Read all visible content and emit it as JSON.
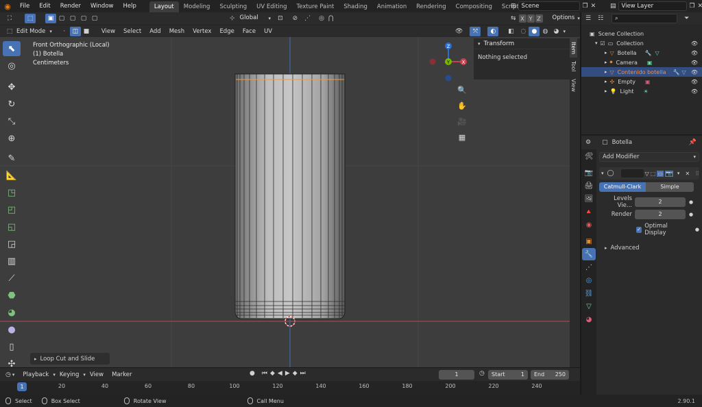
{
  "menu": [
    "File",
    "Edit",
    "Render",
    "Window",
    "Help"
  ],
  "workspaces": [
    "Layout",
    "Modeling",
    "Sculpting",
    "UV Editing",
    "Texture Paint",
    "Shading",
    "Animation",
    "Rendering",
    "Compositing",
    "Scripting"
  ],
  "active_workspace": "Layout",
  "add_workspace": "+",
  "scene_name": "Scene",
  "view_layer": "View Layer",
  "transform_orientation": "Global",
  "axis_toggles": [
    "X",
    "Y",
    "Z"
  ],
  "options_label": "Options",
  "viewport_header": {
    "mode": "Edit Mode",
    "menus": [
      "View",
      "Select",
      "Add",
      "Mesh",
      "Vertex",
      "Edge",
      "Face",
      "UV"
    ]
  },
  "viewport_info": {
    "line1": "Front Orthographic (Local)",
    "line2": "(1) Botella",
    "line3": "Centimeters"
  },
  "gizmo": {
    "x": "X",
    "y": "Y",
    "z": "Z"
  },
  "npanel": {
    "title": "Transform",
    "message": "Nothing selected",
    "tabs": [
      "Item",
      "Tool",
      "View"
    ]
  },
  "last_operator": "Loop Cut and Slide",
  "outliner": {
    "root": "Scene Collection",
    "collection": "Collection",
    "items": [
      {
        "name": "Botella",
        "icon_color": "#e08a3c"
      },
      {
        "name": "Camera",
        "icon_color": "#e08a3c"
      },
      {
        "name": "Contenido botella",
        "icon_color": "#e08a3c"
      },
      {
        "name": "Empty",
        "icon_color": "#e08a3c"
      },
      {
        "name": "Light",
        "icon_color": "#e08a3c"
      }
    ],
    "selected_index": 2
  },
  "properties": {
    "object_name": "Botella",
    "add_modifier": "Add Modifier",
    "subdiv_types": [
      "Catmull-Clark",
      "Simple"
    ],
    "active_subdiv": "Catmull-Clark",
    "levels_label": "Levels Vie...",
    "levels_value": "2",
    "render_label": "Render",
    "render_value": "2",
    "optimal_display": "Optimal Display",
    "advanced": "Advanced"
  },
  "timeline": {
    "menus": [
      "Playback",
      "Keying",
      "View",
      "Marker"
    ],
    "current_frame": "1",
    "start_label": "Start",
    "start": "1",
    "end_label": "End",
    "end": "250",
    "ticks": [
      "1",
      "20",
      "40",
      "60",
      "80",
      "100",
      "120",
      "140",
      "160",
      "180",
      "200",
      "220",
      "240"
    ]
  },
  "status": {
    "select": "Select",
    "box_select": "Box Select",
    "rotate": "Rotate View",
    "call_menu": "Call Menu",
    "version": "2.90.1"
  },
  "colors": {
    "accent": "#4772b3",
    "x_axis": "#c9414f",
    "y_axis": "#7ab800",
    "z_axis": "#2d6fd1",
    "highlight": "#f08f4a"
  }
}
